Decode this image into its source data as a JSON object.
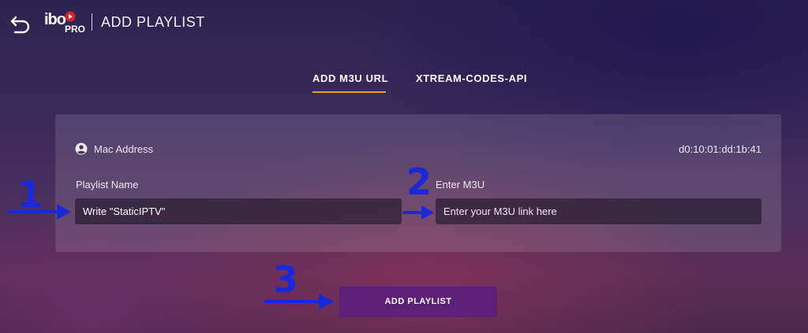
{
  "header": {
    "logo_text": "ibo",
    "logo_sub": "PRO",
    "title": "ADD PLAYLIST"
  },
  "tabs": [
    {
      "label": "ADD M3U URL",
      "active": true
    },
    {
      "label": "XTREAM-CODES-API",
      "active": false
    }
  ],
  "panel": {
    "mac_label": "Mac Address",
    "mac_value": "d0:10:01:dd:1b:41",
    "playlist_name_label": "Playlist Name",
    "playlist_name_value": "Write \"StaticIPTV\"",
    "m3u_label": "Enter M3U",
    "m3u_placeholder": "Enter your M3U link here"
  },
  "button": {
    "label": "ADD PLAYLIST"
  },
  "annotations": {
    "step1": "1",
    "step2": "2",
    "step3": "3"
  },
  "colors": {
    "accent": "#f0a01e",
    "button": "#5e1f78",
    "annotation": "#1b28d8"
  },
  "icons": [
    "back-arrow-icon",
    "logo-icon",
    "user-icon"
  ]
}
